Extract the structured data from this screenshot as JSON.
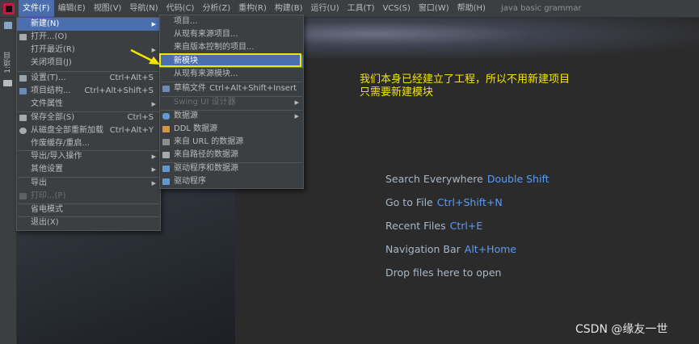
{
  "window_title": "java basic grammar",
  "menubar": [
    "文件(F)",
    "编辑(E)",
    "视图(V)",
    "导航(N)",
    "代码(C)",
    "分析(Z)",
    "重构(R)",
    "构建(B)",
    "运行(U)",
    "工具(T)",
    "VCS(S)",
    "窗口(W)",
    "帮助(H)"
  ],
  "toolstrip": {
    "project_tab": "1:项目"
  },
  "file_menu": [
    {
      "label": "新建(N)",
      "arrow": "▶",
      "icon": "none"
    },
    {
      "label": "打开...(O)",
      "icon": "folder-icon"
    },
    {
      "label": "打开最近(R)",
      "arrow": "▶"
    },
    {
      "label": "关闭项目(J)"
    },
    {
      "label": "设置(T)...",
      "shortcut": "Ctrl+Alt+S",
      "icon": "wrench-icon"
    },
    {
      "label": "项目结构...",
      "shortcut": "Ctrl+Alt+Shift+S",
      "icon": "project-structure-icon"
    },
    {
      "label": "文件属性",
      "arrow": "▶"
    },
    {
      "label": "保存全部(S)",
      "shortcut": "Ctrl+S",
      "icon": "save-icon"
    },
    {
      "label": "从磁盘全部重新加载",
      "shortcut": "Ctrl+Alt+Y",
      "icon": "reload-icon"
    },
    {
      "label": "作废缓存/重启..."
    },
    {
      "label": "导出/导入操作",
      "arrow": "▶"
    },
    {
      "label": "其他设置",
      "arrow": "▶"
    },
    {
      "label": "导出",
      "arrow": "▶"
    },
    {
      "label": "打印...(P)",
      "icon": "print-icon"
    },
    {
      "label": "省电模式"
    },
    {
      "label": "退出(X)"
    }
  ],
  "new_submenu": [
    {
      "label": "项目..."
    },
    {
      "label": "从现有来源项目..."
    },
    {
      "label": "来自版本控制的项目..."
    },
    {
      "label": "新模块"
    },
    {
      "label": "从现有来源模块..."
    },
    {
      "label": "草稿文件",
      "shortcut": "Ctrl+Alt+Shift+Insert",
      "icon": "scratch-file-icon"
    },
    {
      "label": "Swing UI 设计器",
      "arrow": "▶"
    },
    {
      "label": "数据源",
      "arrow": "▶",
      "icon": "database-icon"
    },
    {
      "label": "DDL 数据源",
      "icon": "ddl-icon"
    },
    {
      "label": "来自 URL 的数据源",
      "icon": "url-datasource-icon"
    },
    {
      "label": "来自路径的数据源",
      "icon": "path-datasource-icon"
    },
    {
      "label": "驱动程序和数据源",
      "icon": "driver-datasource-icon"
    },
    {
      "label": "驱动程序",
      "icon": "driver-icon"
    }
  ],
  "annotation": [
    "我们本身已经建立了工程，所以不用新建项目",
    "只需要新建模块"
  ],
  "hints": [
    {
      "text": "Search Everywhere",
      "key": "Double Shift"
    },
    {
      "text": "Go to File",
      "key": "Ctrl+Shift+N"
    },
    {
      "text": "Recent Files",
      "key": "Ctrl+E"
    },
    {
      "text": "Navigation Bar",
      "key": "Alt+Home"
    },
    {
      "text": "Drop files here to open",
      "key": ""
    }
  ],
  "watermark": "CSDN @缘友一世",
  "colors": {
    "highlight": "#4b6eaf",
    "annotation": "#f2e600",
    "shortcut_key": "#589df6",
    "menu_bg": "#3c3f41"
  }
}
